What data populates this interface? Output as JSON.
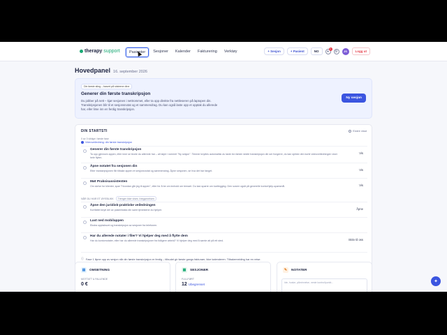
{
  "nav": {
    "logo_part1": "therapy",
    "logo_part2": "support",
    "links": [
      "Pasienter",
      "Sesjoner",
      "Kalender",
      "Fakturering",
      "Verktøy"
    ],
    "new_session": "+ Sesjon",
    "new_patient": "+ Pasient",
    "language": "NO",
    "notification_count": "1",
    "avatar_initials": "JS",
    "logout": "Logg ut"
  },
  "header": {
    "title": "Hovedpanel",
    "date": "16. september 2026"
  },
  "hero": {
    "tag": "Din første sting – basert på sisteene dine",
    "title": "Generer din første transkripsjon",
    "desc": "Du jobber på nett – kjør sesjonen i nettrommet, eller ta opp direkte fra nettleseren på laptopen din. Transkripsjonen blir til et sesjonsnotat og et sammendrag. Du kan også laste opp et opptak du allerede har, eller lime inn en ferdig transkripsjon.",
    "button": "Ny sesjon"
  },
  "start": {
    "heading": "DIN STARTSTI",
    "hide": "Endre visst",
    "progress": "0 av 3 viktige i første fase",
    "done": "Videoveiledning: din første transkripsjon",
    "tasks": [
      {
        "title": "Generer din første transkripsjon",
        "desc": "Ta opp gjennom appen, eller inne se teorie du allerede har – alt skjer i rommet \"Ny sesjon\". Timmer knyttes automatisk av laste inn første nestle transkripsjon din ser fungerer, du kan sjekke den korte videoveiledningen viser hele flyten.",
        "action": "Vis"
      },
      {
        "title": "Åpne notatet fra sesjonen din",
        "desc": "Etter transkripsjonen får tilbake appen et sesjonsnotat og sammendrag. Åpne sesjonen, se hva det har fanget.",
        "action": "Vis"
      },
      {
        "title": "Møt Praksisassistenten",
        "desc": "Om skrive for klienter, spør \"Hvordan går jeg til appen\", eller for å be om innhold om temaet. Du kan spørre om kartlegging. Den svarer også på generelle kontorhjelp-spørsmål.",
        "action": "Vis"
      }
    ],
    "optional_label": "NÅR DU HAR ET ØYEBLIKK",
    "optional_pill": "Trenger ikke vises i begynnelsen",
    "optional_tasks": [
      {
        "title": "Åpne den juridisk-praktiske veiledningen",
        "desc": "Kortfattet knytt del av pasientdata din samt tjenestene du hjelper.",
        "action": "Åpne"
      },
      {
        "title": "Last ned mobilappen",
        "desc": "Ekstra opptaksvei og transkripsjon av sesjoner fra telefonen.",
        "action": ""
      },
      {
        "title": "Har du allerede notater i filer? Vi hjelper deg med å flytte dem",
        "desc": "Har du kontornotater, eller har du allerede transkripsjoner fra tidligere arbeid? Vi hjelper deg med å samle alt på ett sted.",
        "action": "Skriv til oss"
      }
    ],
    "footnote": "Fase 1 åpne opp av sesjon når din første transkripsjon er ferdig – tilbudet gir første gangs fakturaer, ikke kalenderen. Tilbakemelding har en reise."
  },
  "cards": {
    "revenue_title": "OMSETNING",
    "revenue_sub": "MOTTATT & FALLENDE",
    "revenue_value": "0 €",
    "sessions_title": "SESJONER",
    "sessions_sub": "FULLFØRT",
    "sessions_value": "12",
    "sessions_extra": "Ubegrenset",
    "notes_title": "NOTATER",
    "notes_placeholder": "Ide, huske, påminnelse, neste kontrollpunkt..."
  }
}
